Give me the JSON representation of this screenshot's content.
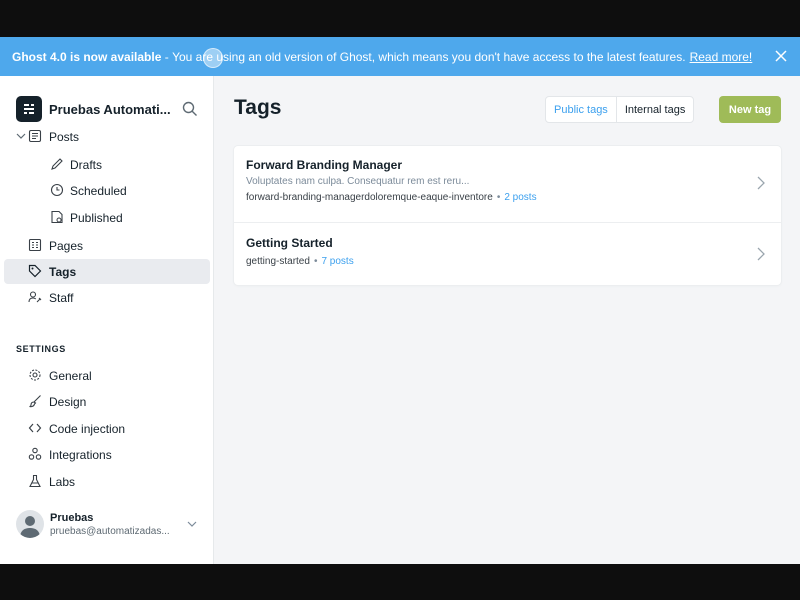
{
  "banner": {
    "title": "Ghost 4.0 is now available",
    "dash": " - ",
    "message": "You are using an old version of Ghost, which means you don't have access to the latest features.",
    "link": "Read more!",
    "bg": "#4ea8ec"
  },
  "sidebar": {
    "site_title": "Pruebas Automati...",
    "items": [
      {
        "label": "Posts",
        "icon": "posts-icon"
      },
      {
        "label": "Drafts",
        "icon": "pencil-icon"
      },
      {
        "label": "Scheduled",
        "icon": "clock-icon"
      },
      {
        "label": "Published",
        "icon": "published-icon"
      },
      {
        "label": "Pages",
        "icon": "pages-icon"
      },
      {
        "label": "Tags",
        "icon": "tag-icon",
        "active": true
      },
      {
        "label": "Staff",
        "icon": "staff-icon"
      }
    ],
    "settings_label": "SETTINGS",
    "settings": [
      {
        "label": "General",
        "icon": "gear-icon"
      },
      {
        "label": "Design",
        "icon": "brush-icon"
      },
      {
        "label": "Code injection",
        "icon": "code-icon"
      },
      {
        "label": "Integrations",
        "icon": "integrations-icon"
      },
      {
        "label": "Labs",
        "icon": "flask-icon"
      }
    ],
    "user": {
      "name": "Pruebas",
      "email": "pruebas@automatizadas..."
    }
  },
  "main": {
    "title": "Tags",
    "tabs": [
      {
        "label": "Public tags",
        "active": true
      },
      {
        "label": "Internal tags",
        "active": false
      }
    ],
    "new_button": "New tag",
    "tags": [
      {
        "name": "Forward Branding Manager",
        "description": "Voluptates nam culpa. Consequatur rem est reru...",
        "slug": "forward-branding-managerdoloremque-eaque-inventore",
        "separator": "•",
        "count": "2 posts"
      },
      {
        "name": "Getting Started",
        "description": "",
        "slug": "getting-started",
        "separator": "•",
        "count": "7 posts"
      }
    ]
  },
  "colors": {
    "accent": "#3ca0ee",
    "new_button": "#9fbb58",
    "active_nav": "#e9ebef"
  }
}
